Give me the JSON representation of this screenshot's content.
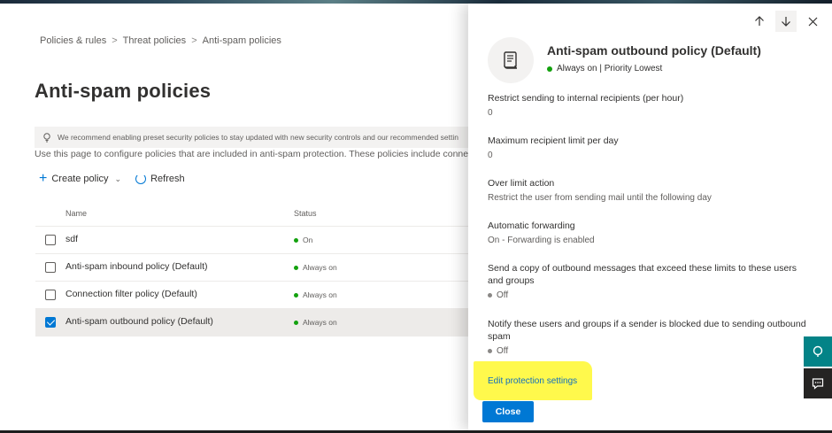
{
  "breadcrumb": {
    "items": [
      "Policies & rules",
      "Threat policies",
      "Anti-spam policies"
    ],
    "separator": ">"
  },
  "page": {
    "title": "Anti-spam policies",
    "banner": "We recommend enabling preset security policies to stay updated with new security controls and our recommended settin",
    "description": "Use this page to configure policies that are included in anti-spam protection. These policies include connectio"
  },
  "commands": {
    "create_policy": "Create policy",
    "refresh": "Refresh"
  },
  "table": {
    "columns": {
      "name": "Name",
      "status": "Status"
    },
    "rows": [
      {
        "name": "sdf",
        "status": "On",
        "checked": false
      },
      {
        "name": "Anti-spam inbound policy (Default)",
        "status": "Always on",
        "checked": false
      },
      {
        "name": "Connection filter policy (Default)",
        "status": "Always on",
        "checked": false
      },
      {
        "name": "Anti-spam outbound policy (Default)",
        "status": "Always on",
        "checked": true
      }
    ]
  },
  "panel": {
    "title": "Anti-spam outbound policy (Default)",
    "subtitle": "Always on | Priority Lowest",
    "fields": [
      {
        "label": "Restrict sending to internal recipients (per hour)",
        "value": "0"
      },
      {
        "label": "Maximum recipient limit per day",
        "value": "0"
      },
      {
        "label": "Over limit action",
        "value": "Restrict the user from sending mail until the following day"
      },
      {
        "label": "Automatic forwarding",
        "value": "On - Forwarding is enabled"
      },
      {
        "label": "Send a copy of outbound messages that exceed these limits to these users and groups",
        "value": "Off"
      },
      {
        "label": "Notify these users and groups if a sender is blocked due to sending outbound spam",
        "value": "Off"
      }
    ],
    "edit_link": "Edit protection settings",
    "close_label": "Close"
  },
  "colors": {
    "accent": "#0078d4",
    "status_green": "#13a10e",
    "highlight": "#fff94c"
  },
  "icons": {
    "panel_avatar": "policy-scroll-icon",
    "side_tab_1": "help-icon",
    "side_tab_2": "feedback-icon"
  }
}
